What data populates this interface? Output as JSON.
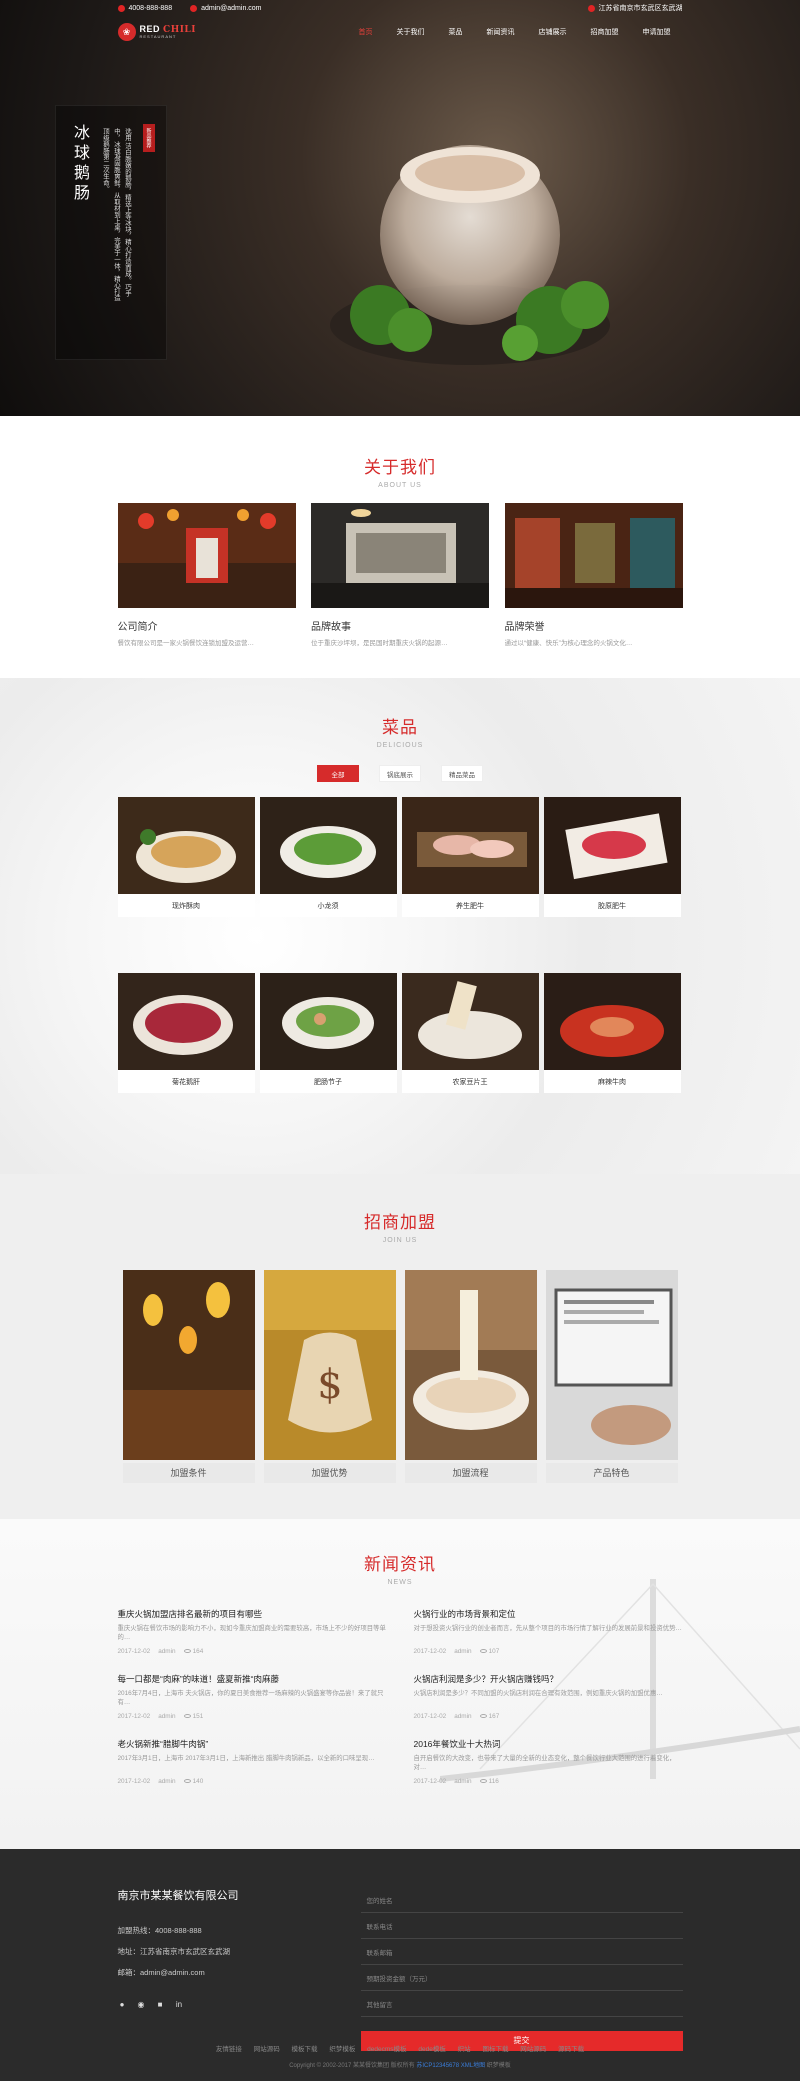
{
  "topbar": {
    "phone": "4008-888-888",
    "email": "admin@admin.com",
    "address": "江苏省南京市玄武区玄武湖"
  },
  "logo": {
    "main": "RED",
    "accent": "CHILI",
    "sub": "RESTAURANT"
  },
  "nav": [
    "首页",
    "关于我们",
    "菜品",
    "新闻资讯",
    "店铺展示",
    "招商加盟",
    "申请加盟"
  ],
  "hero": {
    "title": "冰球鹅肠",
    "stamp": "新品推荐",
    "text": "选用 洁白脆嫩的鹅肠，精选上等冰块，精心打造而成。巧手中，冰球凝固脆爽鲜，从取材到上桌，完美于一体，精心打造顶级鹅肠第二次生命。"
  },
  "about": {
    "title": "关于我们",
    "subtitle": "ABOUT US",
    "cards": [
      {
        "title": "公司简介",
        "desc": "餐饮有限公司是一家火锅餐饮连锁加盟及运营…"
      },
      {
        "title": "品牌故事",
        "desc": "位于重庆沙坪坝，是民国时期重庆火锅的起源…"
      },
      {
        "title": "品牌荣誉",
        "desc": "通过以“健康、快乐”为核心理念的火锅文化…"
      }
    ]
  },
  "dishes": {
    "title": "菜品",
    "subtitle": "DELICIOUS",
    "tabs": [
      "全部",
      "锅底展示",
      "精品菜品"
    ],
    "items": [
      "现炸酥肉",
      "小龙须",
      "养生肥牛",
      "胶原肥牛",
      "菊花鹅肝",
      "肥肠节子",
      "农家豆片王",
      "麻辣牛肉"
    ]
  },
  "join": {
    "title": "招商加盟",
    "subtitle": "JOIN US",
    "items": [
      "加盟条件",
      "加盟优势",
      "加盟流程",
      "产品特色"
    ]
  },
  "news": {
    "title": "新闻资讯",
    "subtitle": "NEWS",
    "items": [
      {
        "title": "重庆火锅加盟店排名最新的项目有哪些",
        "summary": "重庆火锅在餐饮市场的影响力不小，现如今重庆加盟商业的需要较高，市场上不少的好项目等单的…",
        "date": "2017-12-02",
        "author": "admin",
        "views": "164"
      },
      {
        "title": "火锅行业的市场背景和定位",
        "summary": "对于想投资火锅行业的创业者而言，先从整个项目的市场行情了解行业的发展前景和投资优势…",
        "date": "2017-12-02",
        "author": "admin",
        "views": "107"
      },
      {
        "title": "每一口都是“肉麻”的味道！盛夏新推“肉麻藤",
        "summary": "2016年7月4日，上海市 夫火锅店，你的夏日美食推荐一场麻辣的火锅盛宴等你品尝！来了就只有…",
        "date": "2017-12-02",
        "author": "admin",
        "views": "151"
      },
      {
        "title": "火锅店利润是多少？开火锅店赚钱吗？",
        "summary": "火锅店利润是多少？不同加盟的火锅店利润在合理有效范围，例如重庆火锅的加盟优惠…",
        "date": "2017-12-02",
        "author": "admin",
        "views": "167"
      },
      {
        "title": "老火锅新推“腊脚牛肉锅”",
        "summary": "2017年3月1日，上海市 2017年3月1日，上海新推出 腊脚牛肉锅新品，以全新的口味呈现…",
        "date": "2017-12-02",
        "author": "admin",
        "views": "140"
      },
      {
        "title": "2016年餐饮业十大热词",
        "summary": "自开启餐饮的大改变，也带来了大量的全新的业态变化，整个餐饮行业大范围的进行着变化，对…",
        "date": "2017-12-02",
        "author": "admin",
        "views": "116"
      }
    ]
  },
  "footer": {
    "company": "南京市某某餐饮有限公司",
    "hotline": "加盟热线：4008-888-888",
    "address": "地址：江苏省南京市玄武区玄武湖",
    "email": "邮箱：admin@admin.com",
    "form": [
      "您的姓名",
      "联系电话",
      "联系邮箱",
      "预期投资金额（万元）",
      "其他留言"
    ],
    "submit": "提交",
    "links": [
      "友情链接",
      "网站源码",
      "模板下载",
      "织梦模板",
      "dedecms模板",
      "dede模板",
      "织站",
      "图标下载",
      "网站源码",
      "源码下载"
    ],
    "copyright": "Copyright © 2002-2017 某某餐饮集团 版权所有",
    "icp": "苏ICP12345678",
    "sitemap": "XML地图",
    "powered": "织梦模板"
  },
  "colors": {
    "accent": "#d62b2b",
    "footer_bg": "#2b2b2b"
  }
}
